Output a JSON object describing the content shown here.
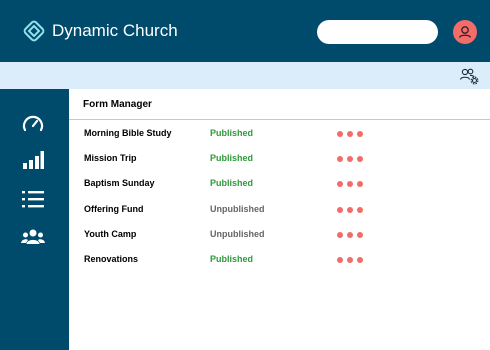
{
  "app": {
    "brand": "Dynamic Church"
  },
  "search": {
    "placeholder": ""
  },
  "main": {
    "title": "Form Manager",
    "forms": [
      {
        "name": "Morning Bible Study",
        "status": "Published"
      },
      {
        "name": "Mission Trip",
        "status": "Published"
      },
      {
        "name": "Baptism Sunday",
        "status": "Published"
      },
      {
        "name": "Offering Fund",
        "status": "Unpublished"
      },
      {
        "name": "Youth Camp",
        "status": "Unpublished"
      },
      {
        "name": "Renovations",
        "status": "Published"
      }
    ]
  },
  "icons": {
    "logo": "church-logo-icon",
    "avatar": "user-avatar-icon",
    "subbar": "users-settings-icon",
    "sidebar": [
      "dashboard-gauge-icon",
      "bar-chart-icon",
      "list-icon",
      "people-group-icon"
    ],
    "row_action": "more-dots-icon"
  },
  "colors": {
    "primary": "#004a6b",
    "subbar": "#dbedfb",
    "accent": "#f26c6a",
    "published": "#2e9a3a",
    "unpublished": "#666666"
  }
}
